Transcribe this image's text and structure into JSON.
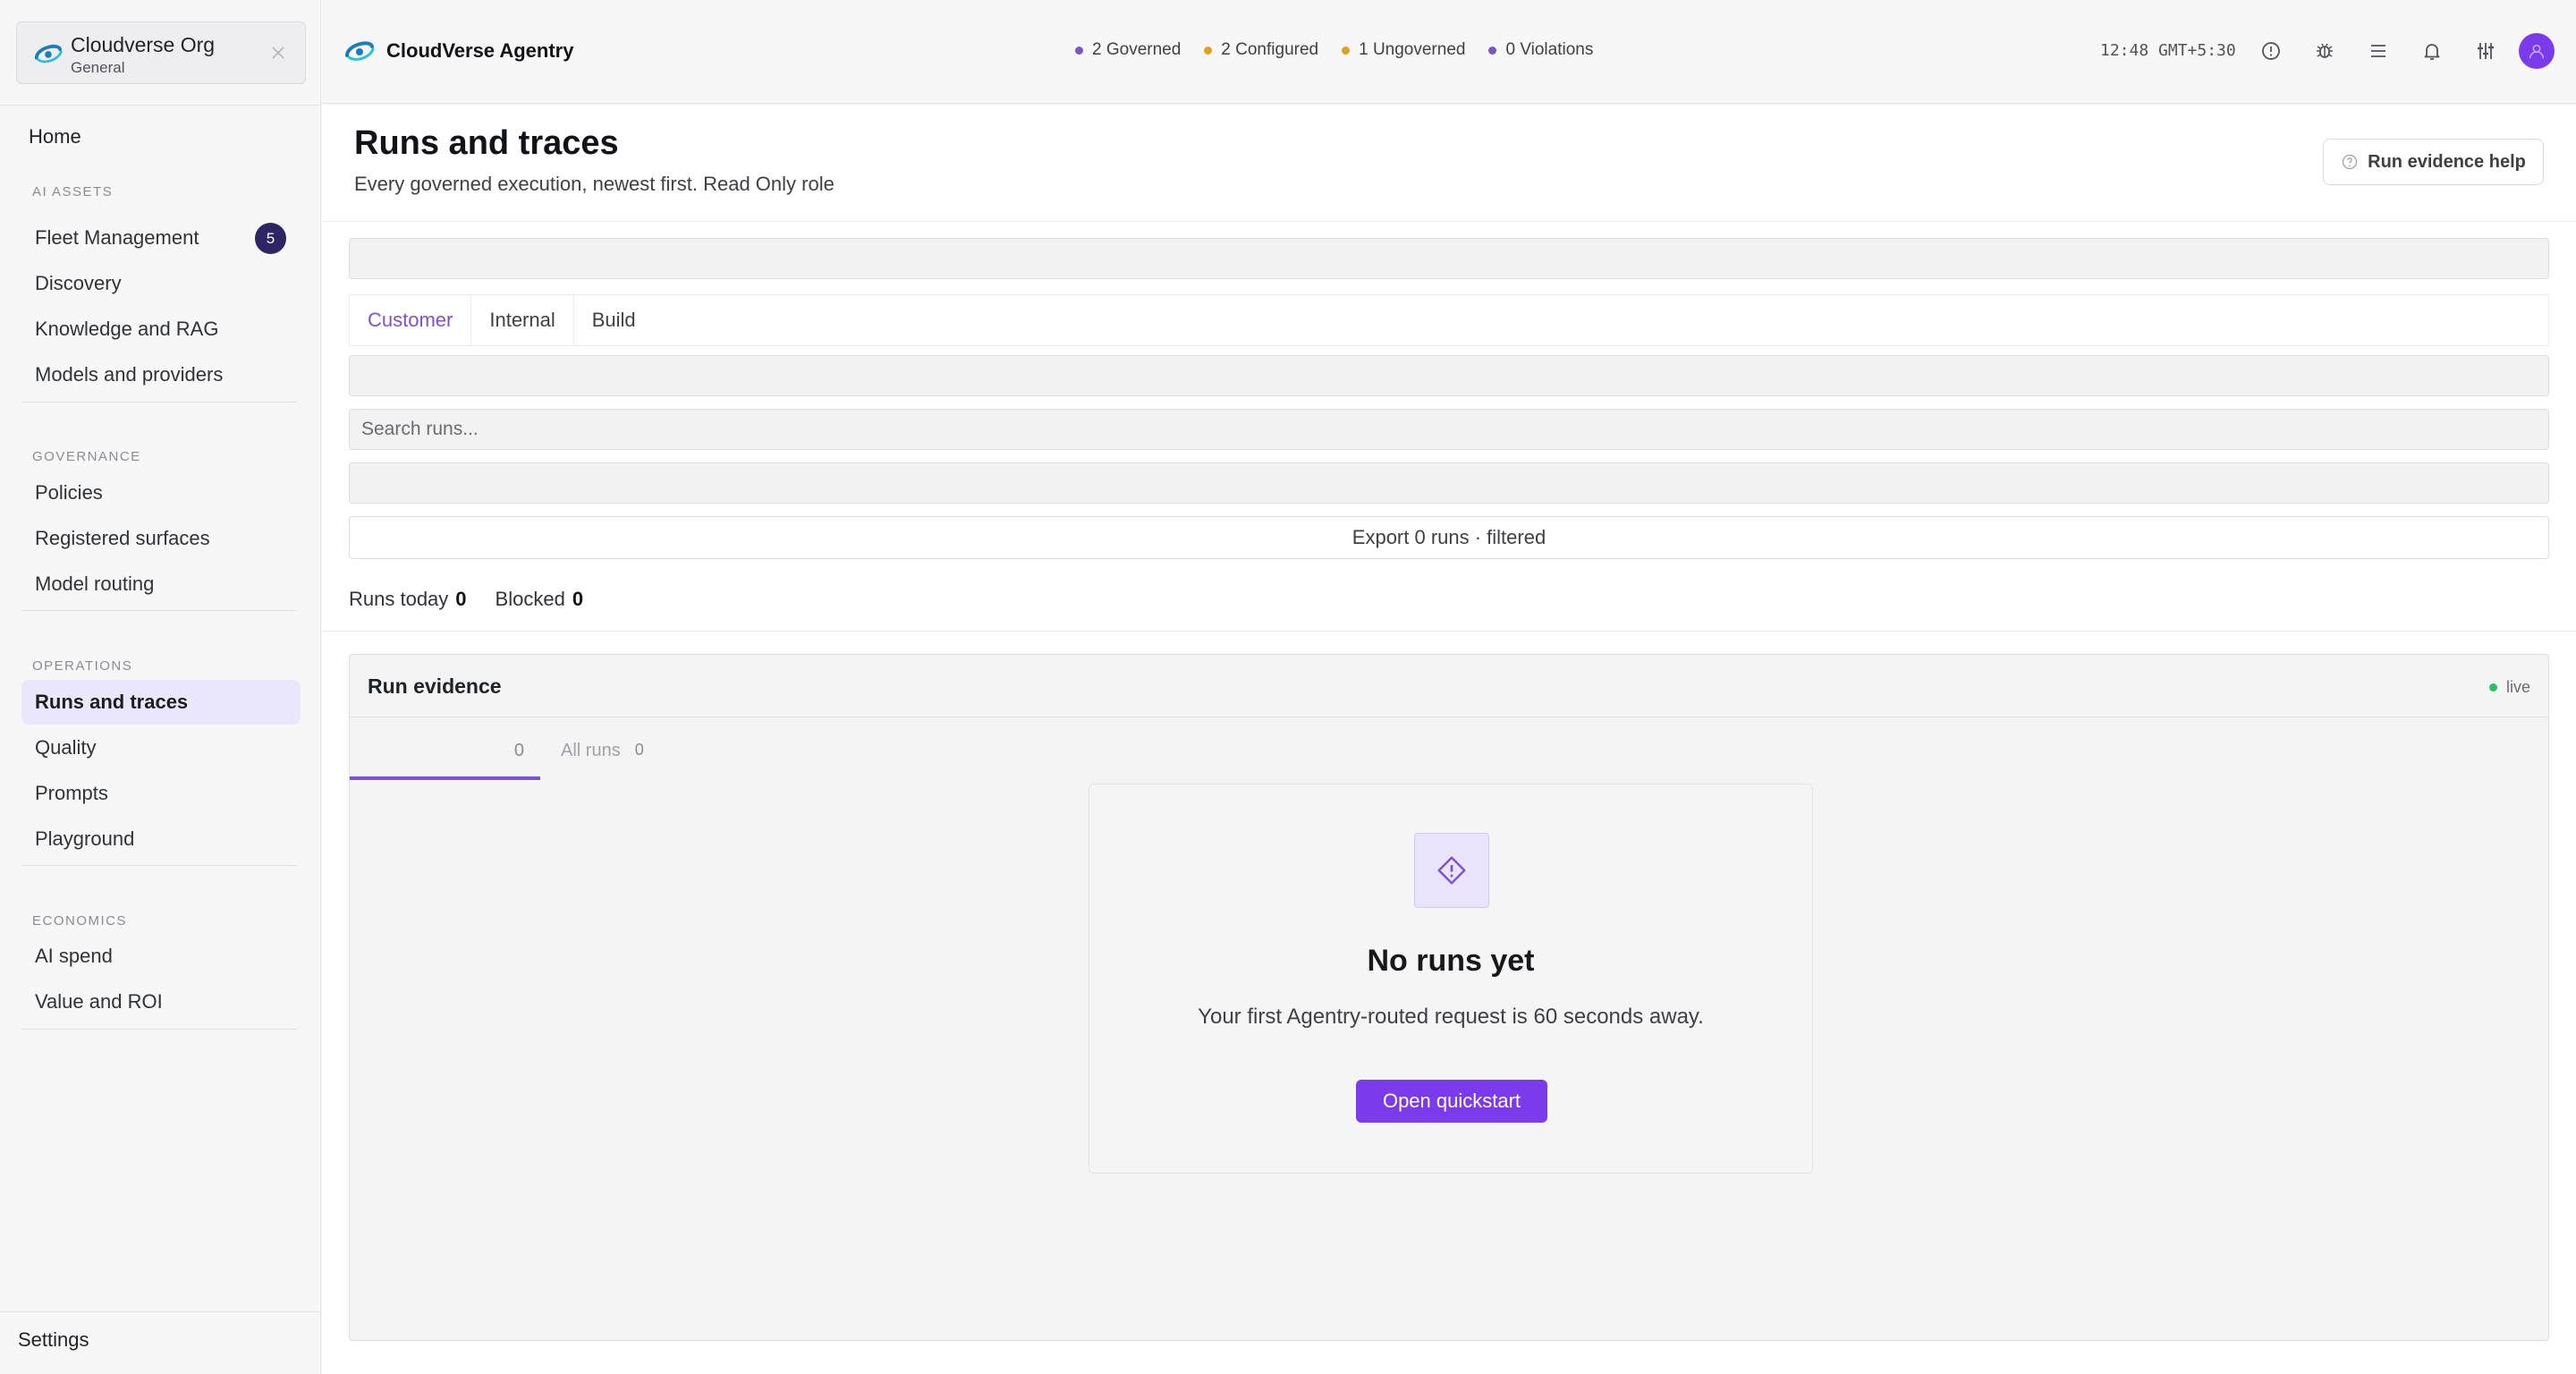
{
  "org": {
    "name": "Cloudverse Org",
    "workspace": "General"
  },
  "sidebar": {
    "home": "Home",
    "sections": [
      {
        "label": "AI Assets",
        "items": [
          {
            "label": "Fleet Management",
            "badge": "5"
          },
          {
            "label": "Discovery"
          },
          {
            "label": "Knowledge and RAG"
          },
          {
            "label": "Models and providers"
          }
        ]
      },
      {
        "label": "Governance",
        "items": [
          {
            "label": "Policies"
          },
          {
            "label": "Registered surfaces"
          },
          {
            "label": "Model routing"
          }
        ]
      },
      {
        "label": "Operations",
        "items": [
          {
            "label": "Runs and traces",
            "active": true
          },
          {
            "label": "Quality"
          },
          {
            "label": "Prompts"
          },
          {
            "label": "Playground"
          }
        ]
      },
      {
        "label": "Economics",
        "items": [
          {
            "label": "AI spend"
          },
          {
            "label": "Value and ROI"
          }
        ]
      }
    ],
    "settings": "Settings"
  },
  "header": {
    "brand": "CloudVerse Agentry",
    "status": [
      {
        "label": "2 Governed",
        "color": "#7c54c7"
      },
      {
        "label": "2 Configured",
        "color": "#e0a21a"
      },
      {
        "label": "1 Ungoverned",
        "color": "#e0a21a"
      },
      {
        "label": "0 Violations",
        "color": "#7c54c7"
      }
    ],
    "clock": "12:48 GMT+5:30",
    "icons": [
      "info-icon",
      "bug-icon",
      "list-icon",
      "bell-icon",
      "sliders-icon"
    ]
  },
  "page": {
    "title": "Runs and traces",
    "subtitle": "Every governed execution, newest first. Read Only role",
    "help_button": "Run evidence help",
    "tabs": [
      "Customer",
      "Internal",
      "Build"
    ],
    "active_tab": "Customer",
    "search_placeholder": "Search runs...",
    "export_label": "Export 0 runs · filtered",
    "stats": [
      {
        "label": "Runs today",
        "value": "0"
      },
      {
        "label": "Blocked",
        "value": "0"
      }
    ]
  },
  "panel": {
    "title": "Run evidence",
    "live": "live",
    "tabs": [
      {
        "label": "",
        "count": "0"
      },
      {
        "label": "All runs",
        "count": "0"
      }
    ],
    "empty": {
      "title": "No runs yet",
      "text": "Your first Agentry-routed request is 60 seconds away.",
      "button": "Open quickstart"
    }
  },
  "colors": {
    "accent": "#7c3aed",
    "live": "#22c55e"
  }
}
